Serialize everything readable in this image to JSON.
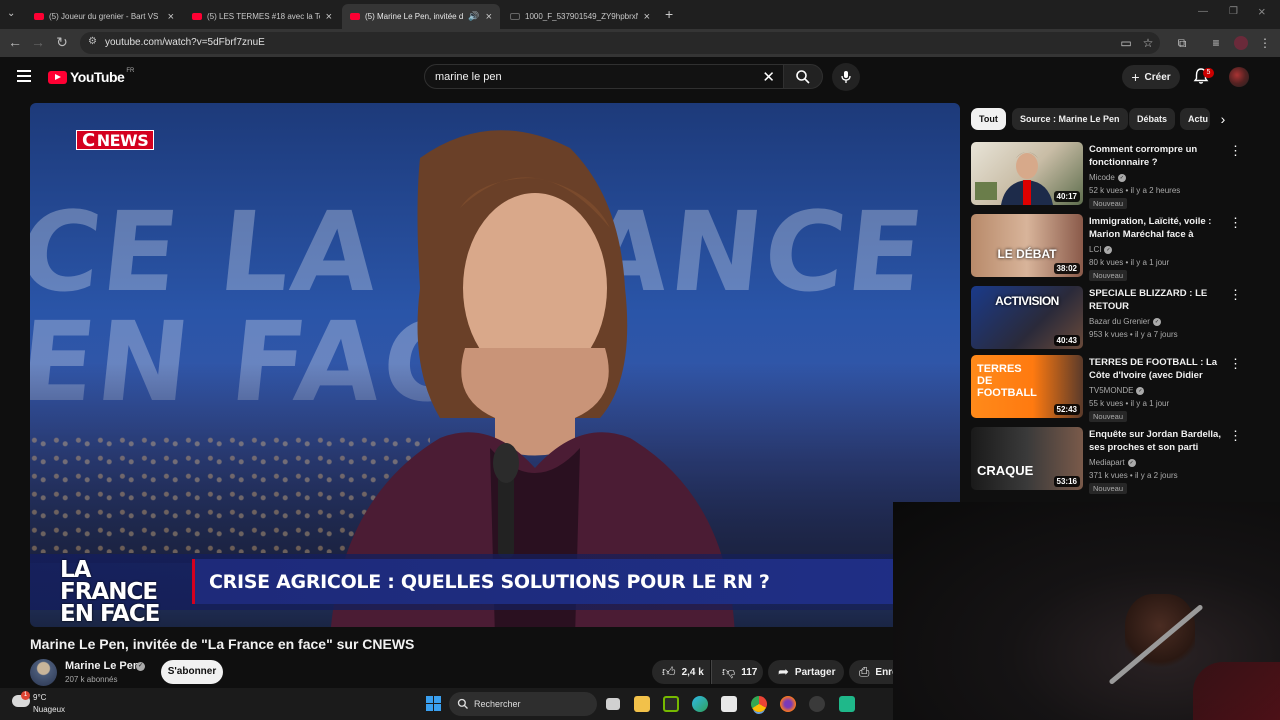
{
  "browser": {
    "tabs": [
      {
        "title": "(5) Joueur du grenier - Bart VS",
        "active": false
      },
      {
        "title": "(5) LES TERMES #18 avec la Tea",
        "active": false
      },
      {
        "title": "(5) Marine Le Pen, invitée d",
        "active": true
      },
      {
        "title": "1000_F_537901549_ZY9hpbrxN",
        "active": false
      }
    ],
    "url": "youtube.com/watch?v=5dFbrf7znuE"
  },
  "youtube": {
    "logo_text": "YouTube",
    "country": "FR",
    "search_value": "marine le pen",
    "create_label": "Créer",
    "notifications": "5"
  },
  "player": {
    "bg_text_1": "CE LA FRANCE",
    "bg_text_2": "EN FACE",
    "channel_logo": "NEWS",
    "channel_logo_c": "C",
    "show_title_1": "LA FRANCE",
    "show_title_2": "EN FACE",
    "headline": "CRISE AGRICOLE : QUELLES SOLUTIONS POUR LE RN ?"
  },
  "video": {
    "title": "Marine Le Pen, invitée de \"La France en face\" sur CNEWS",
    "channel": "Marine Le Pen",
    "subscribers": "207 k abonnés",
    "subscribe_label": "S'abonner",
    "likes": "2,4 k",
    "dislikes": "117",
    "share_label": "Partager",
    "save_label": "Enre"
  },
  "chips": [
    "Tout",
    "Source : Marine Le Pen",
    "Débats",
    "Actu"
  ],
  "recommendations": [
    {
      "title": "Comment corrompre un fonctionnaire ?",
      "channel": "Micode",
      "meta": "52 k vues • il y a 2 heures",
      "badge": "Nouveau",
      "duration": "40:17"
    },
    {
      "title": "Immigration, Laïcité, voile : Marion Maréchal face à Marin...",
      "channel": "LCI",
      "meta": "80 k vues • il y a 1 jour",
      "badge": "Nouveau",
      "duration": "38:02",
      "thumb_text": "LE DÉBAT"
    },
    {
      "title": "SPECIALE BLIZZARD : LE RETOUR",
      "channel": "Bazar du Grenier",
      "meta": "953 k vues • il y a 7 jours",
      "badge": "",
      "duration": "40:43",
      "thumb_text": "ACTIVISION"
    },
    {
      "title": "TERRES DE FOOTBALL : La Côte d'Ivoire (avec Didier Drogba) - ...",
      "channel": "TV5MONDE",
      "meta": "55 k vues • il y a 1 jour",
      "badge": "Nouveau",
      "duration": "52:43",
      "thumb_text": "TERRES DE FOOTBALL"
    },
    {
      "title": "Enquête sur Jordan Bardella, ses proches et son parti",
      "channel": "Mediapart",
      "meta": "371 k vues • il y a 2 jours",
      "badge": "Nouveau",
      "duration": "53:16",
      "thumb_text": "CRAQUE"
    }
  ],
  "taskbar": {
    "temperature": "9°C",
    "condition": "Nuageux",
    "search_placeholder": "Rechercher",
    "weather_badge": "1"
  }
}
